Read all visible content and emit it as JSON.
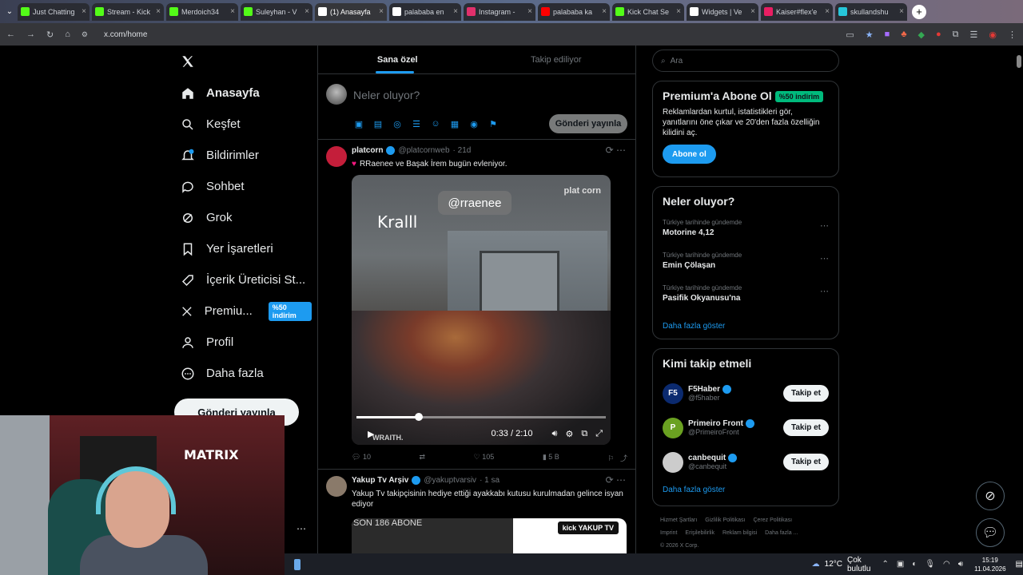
{
  "browser": {
    "tabs": [
      {
        "label": "Just Chatting",
        "color": "#53fc18"
      },
      {
        "label": "Stream - Kick",
        "color": "#53fc18"
      },
      {
        "label": "Merdoich34",
        "color": "#53fc18"
      },
      {
        "label": "Suleyhan - V",
        "color": "#53fc18"
      },
      {
        "label": "(1) Anasayfa",
        "color": "#ffffff"
      },
      {
        "label": "palababa en",
        "color": "#ffffff"
      },
      {
        "label": "Instagram -",
        "color": "#e1306c"
      },
      {
        "label": "palababa ka",
        "color": "#ff0000"
      },
      {
        "label": "Kick Chat Se",
        "color": "#53fc18"
      },
      {
        "label": "Widgets | Ve",
        "color": "#ffffff"
      },
      {
        "label": "Kaiser#flex'e",
        "color": "#e91e63"
      },
      {
        "label": "skullandshu",
        "color": "#26c6da"
      }
    ],
    "url": "x.com/home"
  },
  "nav": {
    "items": [
      {
        "label": "Anasayfa",
        "icon": "home-icon"
      },
      {
        "label": "Keşfet",
        "icon": "search-icon"
      },
      {
        "label": "Bildirimler",
        "icon": "bell-icon"
      },
      {
        "label": "Sohbet",
        "icon": "chat-icon"
      },
      {
        "label": "Grok",
        "icon": "grok-icon"
      },
      {
        "label": "Yer İşaretleri",
        "icon": "bookmark-icon"
      },
      {
        "label": "İçerik Üreticisi St...",
        "icon": "rocket-icon"
      },
      {
        "label": "Premiu...",
        "icon": "x-icon",
        "badge": "%50 indirim"
      },
      {
        "label": "Profil",
        "icon": "profile-icon"
      },
      {
        "label": "Daha fazla",
        "icon": "more-icon"
      }
    ],
    "notification_count": "1",
    "post_button": "Gönderi yayınla"
  },
  "feed": {
    "tabs": [
      "Sana özel",
      "Takip ediliyor"
    ],
    "composer_placeholder": "Neler oluyor?",
    "composer_post": "Gönderi yayınla",
    "tweets": [
      {
        "name": "platcorn",
        "handle": "@platcornweb",
        "time": "· 21d",
        "text": "RRaenee ve Başak İrem bugün evleniyor.",
        "video": {
          "tag": "@rraenee",
          "overlay": "Kralll",
          "logo": "plat corn",
          "watermark": "WRAITH.",
          "time": "0:33 / 2:10",
          "progress": 0.25
        },
        "replies": "10",
        "retweets": "",
        "likes": "105",
        "views": "5 B"
      },
      {
        "name": "Yakup Tv Arşiv",
        "handle": "@yakuptvarsiv",
        "time": "· 1 sa",
        "text": "Yakup Tv takipçisinin hediye ettiği ayakkabı kutusu kurulmadan gelince isyan ediyor",
        "image_text": "SON 186 ABONE",
        "image_logo": "kick YAKUP TV"
      }
    ]
  },
  "sidebar": {
    "search_placeholder": "Ara",
    "premium": {
      "title": "Premium'a Abone Ol",
      "badge": "%50 indirim",
      "desc": "Reklamlardan kurtul, istatistikleri gör, yanıtlarını öne çıkar ve 20'den fazla özelliğin kilidini aç.",
      "button": "Abone ol"
    },
    "trends": {
      "title": "Neler oluyor?",
      "items": [
        {
          "context": "Türkiye tarihinde gündemde",
          "title": "Motorine 4,12"
        },
        {
          "context": "Türkiye tarihinde gündemde",
          "title": "Emin Çölaşan"
        },
        {
          "context": "Türkiye tarihinde gündemde",
          "title": "Pasifik Okyanusu'na"
        }
      ],
      "more": "Daha fazla göster"
    },
    "who_to_follow": {
      "title": "Kimi takip etmeli",
      "items": [
        {
          "name": "F5Haber",
          "handle": "@f5haber",
          "initials": "F5",
          "color": "#0b2a6f"
        },
        {
          "name": "Primeiro Front",
          "handle": "@PrimeiroFront",
          "initials": "P",
          "color": "#6aa121"
        },
        {
          "name": "canbequit",
          "handle": "@canbequit",
          "initials": "",
          "color": "#cccccc"
        }
      ],
      "follow_label": "Takip et",
      "more": "Daha fazla göster"
    },
    "footer": {
      "line1": [
        "Hizmet Şartları",
        "Gizlilik Politikası",
        "Çerez Politikası"
      ],
      "line2": [
        "Imprint",
        "Erişilebilirlik",
        "Reklam bilgisi",
        "Daha fazla ..."
      ],
      "copyright": "© 2026 X Corp."
    }
  },
  "webcam": {
    "sign": "MATRIX"
  },
  "taskbar": {
    "temperature": "12°C",
    "weather": "Çok bulutlu",
    "time": "15:19",
    "date": "11.04.2026"
  }
}
